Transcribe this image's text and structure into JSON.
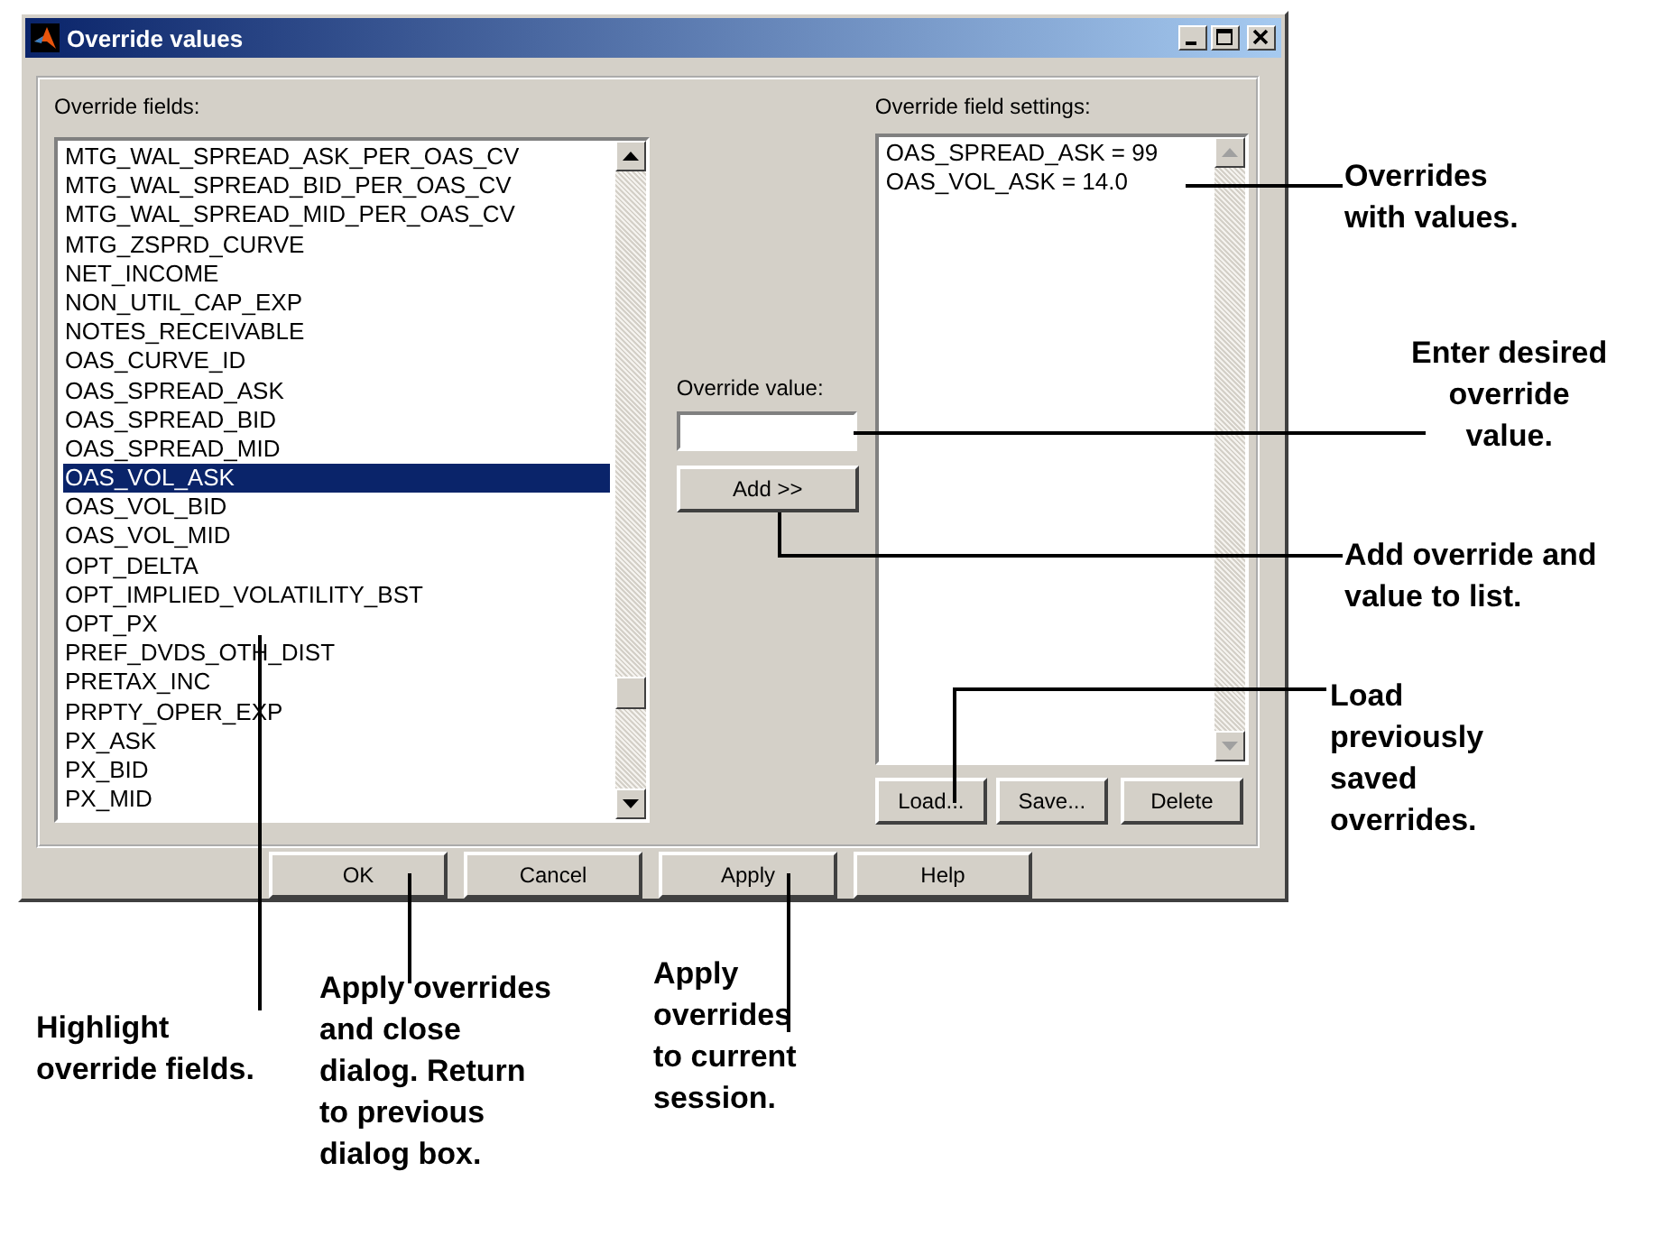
{
  "window": {
    "title": "Override values"
  },
  "fields": {
    "label": "Override fields:",
    "items": [
      {
        "text": "MTG_WAL_SPREAD_ASK_PER_OAS_CV",
        "selected": false
      },
      {
        "text": "MTG_WAL_SPREAD_BID_PER_OAS_CV",
        "selected": false
      },
      {
        "text": "MTG_WAL_SPREAD_MID_PER_OAS_CV",
        "selected": false
      },
      {
        "text": "MTG_ZSPRD_CURVE",
        "selected": false
      },
      {
        "text": "NET_INCOME",
        "selected": false
      },
      {
        "text": "NON_UTIL_CAP_EXP",
        "selected": false
      },
      {
        "text": "NOTES_RECEIVABLE",
        "selected": false
      },
      {
        "text": "OAS_CURVE_ID",
        "selected": false
      },
      {
        "text": "OAS_SPREAD_ASK",
        "selected": false
      },
      {
        "text": "OAS_SPREAD_BID",
        "selected": false
      },
      {
        "text": "OAS_SPREAD_MID",
        "selected": false
      },
      {
        "text": "OAS_VOL_ASK",
        "selected": true
      },
      {
        "text": "OAS_VOL_BID",
        "selected": false
      },
      {
        "text": "OAS_VOL_MID",
        "selected": false
      },
      {
        "text": "OPT_DELTA",
        "selected": false
      },
      {
        "text": "OPT_IMPLIED_VOLATILITY_BST",
        "selected": false
      },
      {
        "text": "OPT_PX",
        "selected": false
      },
      {
        "text": "PREF_DVDS_OTH_DIST",
        "selected": false
      },
      {
        "text": "PRETAX_INC",
        "selected": false
      },
      {
        "text": "PRPTY_OPER_EXP",
        "selected": false
      },
      {
        "text": "PX_ASK",
        "selected": false
      },
      {
        "text": "PX_BID",
        "selected": false
      },
      {
        "text": "PX_MID",
        "selected": false
      }
    ]
  },
  "value": {
    "label": "Override value:",
    "add_button": "Add >>"
  },
  "settings": {
    "label": "Override field settings:",
    "items": [
      "OAS_SPREAD_ASK = 99",
      "OAS_VOL_ASK = 14.0"
    ],
    "buttons": [
      "Load...",
      "Save...",
      "Delete"
    ]
  },
  "buttons": [
    "OK",
    "Cancel",
    "Apply",
    "Help"
  ],
  "callouts": [
    "Overrides\nwith values.",
    "Enter desired\noverride\nvalue.",
    "Add override and\nvalue to list.",
    "Load\npreviously\nsaved\noverrides.",
    "Highlight\noverride fields.",
    "Apply overrides\nand close\ndialog. Return\nto previous\ndialog box.",
    "Apply\noverrides\nto current\nsession."
  ]
}
